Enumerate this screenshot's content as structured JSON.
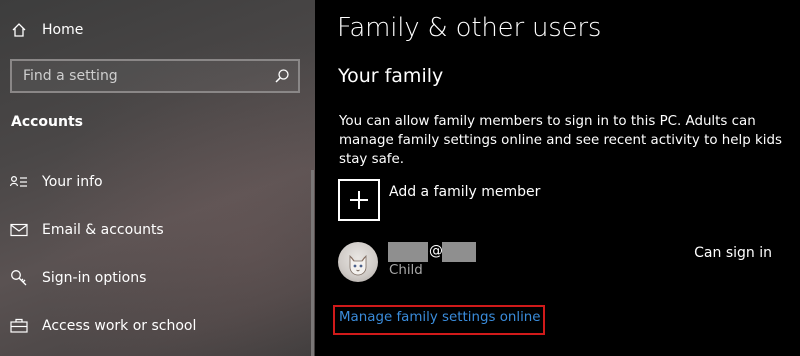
{
  "sidebar": {
    "home_label": "Home",
    "search": {
      "placeholder": "Find a setting",
      "value": ""
    },
    "section_title": "Accounts",
    "items": [
      {
        "label": "Your info",
        "icon": "person-list-icon"
      },
      {
        "label": "Email & accounts",
        "icon": "mail-icon"
      },
      {
        "label": "Sign-in options",
        "icon": "key-icon"
      },
      {
        "label": "Access work or school",
        "icon": "briefcase-icon"
      }
    ]
  },
  "main": {
    "title": "Family & other users",
    "section": "Your family",
    "description": "You can allow family members to sign in to this PC. Adults can manage family settings online and see recent activity to help kids stay safe.",
    "add_member_label": "Add a family member",
    "member": {
      "email_separator": "@",
      "role": "Child",
      "status": "Can sign in"
    },
    "manage_link": "Manage family settings online"
  },
  "colors": {
    "sidebar_bg": "#4a4747",
    "main_bg": "#000000",
    "link": "#3a8cdb",
    "highlight_border": "#d01a1a"
  }
}
